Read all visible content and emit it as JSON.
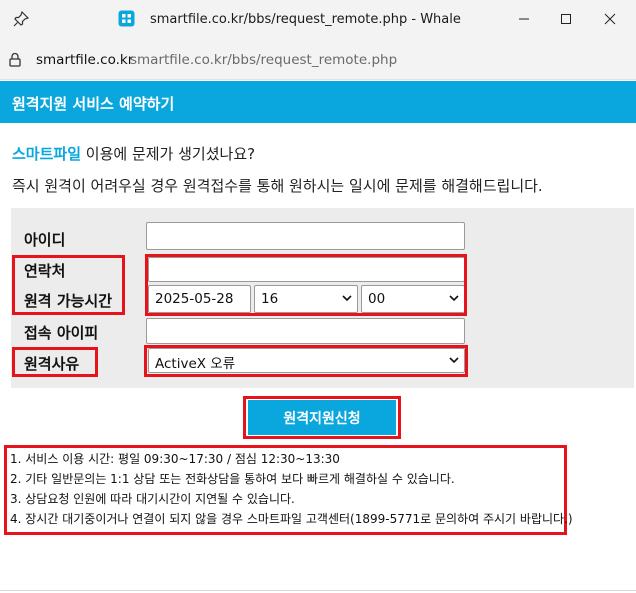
{
  "window": {
    "title": "smartfile.co.kr/bbs/request_remote.php - Whale"
  },
  "address": {
    "domain": "smartfile.co.kr",
    "url": "smartfile.co.kr/bbs/request_remote.php"
  },
  "header": {
    "title": "원격지원 서비스 예약하기"
  },
  "intro": {
    "brand": "스마트파일",
    "line1_rest": " 이용에 문제가 생기셨나요?",
    "line2": "즉시 원격이 어려우실 경우 원격접수를 통해 원하시는 일시에 문제를 해결해드립니다."
  },
  "form": {
    "id_label": "아이디",
    "id_value": "",
    "contact_label": "연락처",
    "contact_value": "",
    "time_label": "원격 가능시간",
    "date_value": "2025-05-28",
    "hour_value": "16",
    "minute_value": "00",
    "ip_label": "접속 아이피",
    "ip_value": "",
    "reason_label": "원격사유",
    "reason_value": "ActiveX 오류"
  },
  "submit_label": "원격지원신청",
  "notes": [
    "1. 서비스 이용 시간: 평일 09:30~17:30 / 점심 12:30~13:30",
    "2. 기타 일반문의는 1:1 상담 또는 전화상담을 통하여 보다 빠르게 해결하실 수 있습니다.",
    "3. 상담요청 인원에 따라 대기시간이 지연될 수 있습니다.",
    "4. 장시간 대기중이거나 연결이 되지 않을 경우 스마트파일 고객센터(1899-5771로 문의하여 주시기 바랍니다.)"
  ],
  "colors": {
    "accent": "#0aa6de",
    "highlight": "#e8121b"
  }
}
